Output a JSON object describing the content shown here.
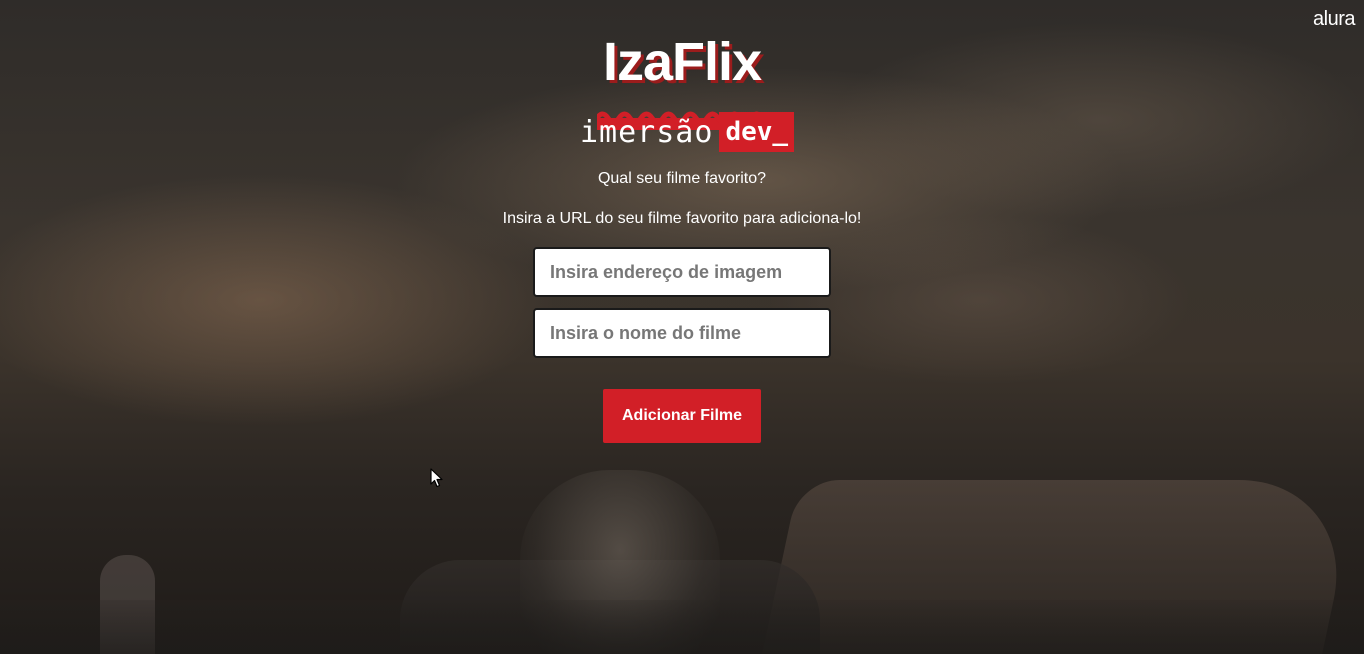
{
  "brand": {
    "alura": "alura",
    "logo": "IzaFlix",
    "imersao_word": "imersão",
    "imersao_tag": "dev_"
  },
  "main": {
    "question": "Qual seu filme favorito?",
    "instruction": "Insira a URL do seu filme favorito para adiciona-lo!",
    "image_input": {
      "placeholder": "Insira endereço de imagem",
      "value": ""
    },
    "name_input": {
      "placeholder": "Insira o nome do filme",
      "value": ""
    },
    "add_button": "Adicionar Filme"
  },
  "colors": {
    "accent": "#d21f27",
    "text": "#ffffff"
  },
  "icons": {
    "cursor": "mouse-pointer-icon"
  }
}
